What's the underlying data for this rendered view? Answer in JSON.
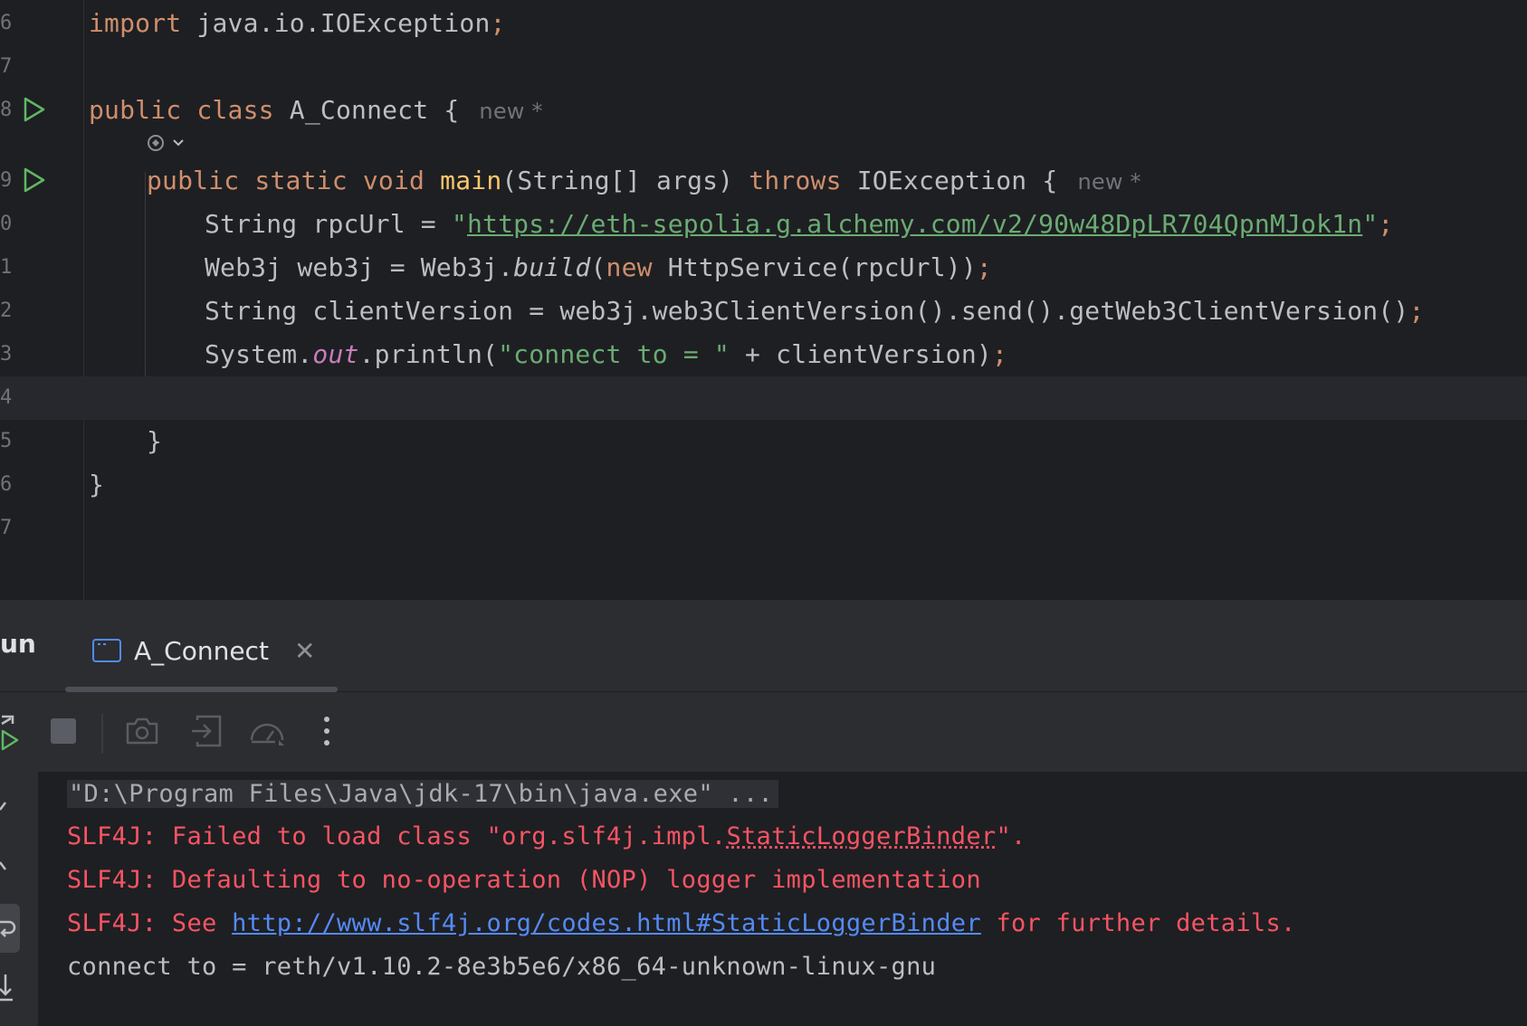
{
  "editor": {
    "line_numbers": [
      "6",
      "7",
      "8",
      "9",
      "0",
      "1",
      "2",
      "3",
      "4",
      "5",
      "6",
      "7"
    ],
    "import_kw": "import",
    "import_rest": " java.io.IOException",
    "semicolon": ";",
    "class_line": {
      "kw1": "public",
      "kw2": "class",
      "name": " A_Connect {",
      "hint": "new *"
    },
    "main_line": {
      "kw1": "public",
      "kw2": "static",
      "kw3": "void",
      "method": "main",
      "params": "(String[] args) ",
      "throws_kw": "throws",
      "exc": " IOException {",
      "hint": "new *"
    },
    "rpc_line": {
      "prefix": "String rpcUrl = ",
      "quote_open": "\"",
      "url": "https://eth-sepolia.g.alchemy.com/v2/90w48DpLR704QpnMJok1n",
      "quote_close": "\""
    },
    "web3j_line": {
      "prefix": "Web3j web3j = Web3j.",
      "method": "build",
      "paren": "(",
      "new_kw": "new",
      "rest": " HttpService(rpcUrl))"
    },
    "client_line": {
      "text": "String clientVersion = web3j.web3ClientVersion().send().getWeb3ClientVersion()"
    },
    "print_line": {
      "prefix": "System.",
      "field": "out",
      "mid": ".println(",
      "str": "\"connect to = \"",
      "rest": " + clientVersion)"
    },
    "close_method": "}",
    "close_class": "}"
  },
  "run_window": {
    "title": "un",
    "tab_label": "A_Connect",
    "tab_close": "✕"
  },
  "console": {
    "cmd": "\"D:\\Program Files\\Java\\jdk-17\\bin\\java.exe\" ...",
    "err1_prefix": "SLF4J: Failed to load class \"org.slf4j.impl.",
    "err1_link": "StaticLoggerBinder",
    "err1_suffix": "\".",
    "err2": "SLF4J: Defaulting to no-operation (NOP) logger implementation",
    "err3_prefix": "SLF4J: See ",
    "err3_link": "http://www.slf4j.org/codes.html#StaticLoggerBinder",
    "err3_suffix": " for further details.",
    "output": "connect to = reth/v1.10.2-8e3b5e6/x86_64-unknown-linux-gnu"
  },
  "colors": {
    "keyword": "#cf8e6d",
    "string": "#6aab73",
    "method_decl": "#ffc66d",
    "error": "#f75464",
    "link": "#548af7",
    "run_green": "#5fb865"
  },
  "icons": [
    "run-gutter-icon",
    "ai-assist-icon",
    "console-tab-icon",
    "close-icon",
    "rerun-icon",
    "stop-icon",
    "screenshot-icon",
    "restore-layout-icon",
    "profiler-icon",
    "more-icon",
    "scroll-up-icon",
    "scroll-down-icon",
    "soft-wrap-icon",
    "scroll-end-icon"
  ]
}
